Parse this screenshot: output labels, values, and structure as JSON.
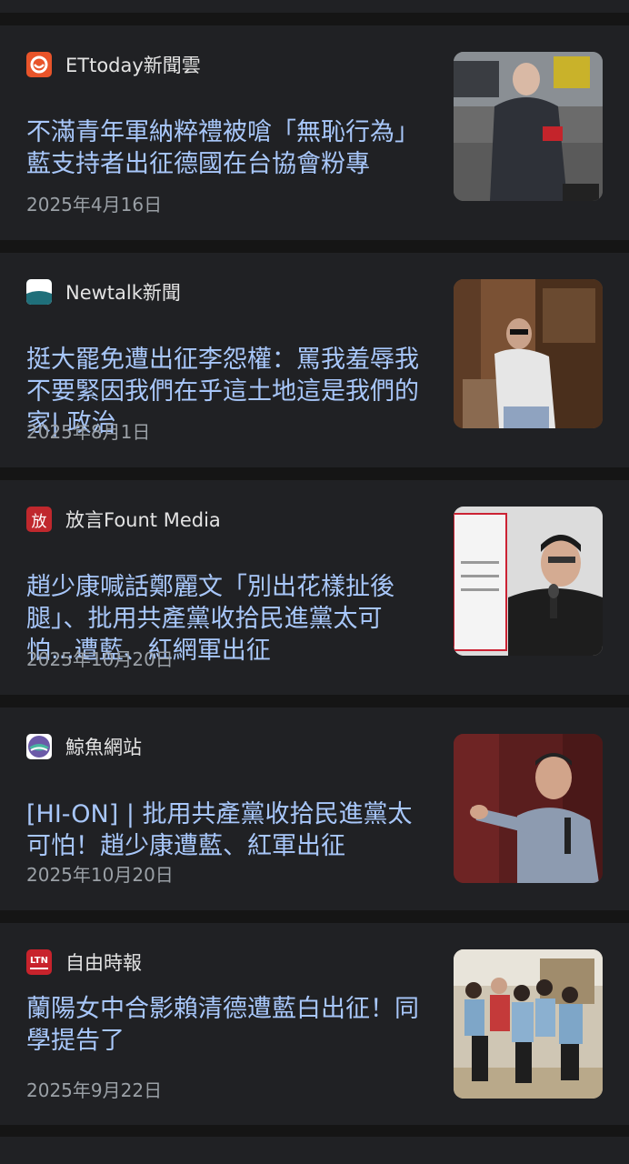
{
  "articles": [
    {
      "source": "ETtoday新聞雲",
      "favicon": "ettoday-logo-icon",
      "title": "不滿青年軍納粹禮被嗆「無恥行為」　藍支持者出征德國在台協會粉專",
      "date": "2025年4月16日",
      "image": "man-armband-photo"
    },
    {
      "source": "Newtalk新聞",
      "favicon": "newtalk-logo-icon",
      "title": "挺大罷免遭出征李怨權：罵我羞辱我不要緊因我們在乎這土地這是我們的家| 政治",
      "date": "2025年8月1日",
      "image": "man-sunglasses-doorway-photo"
    },
    {
      "source": "放言Fount Media",
      "favicon": "fount-media-logo-icon",
      "favicon_text": "放",
      "title": "趙少康喊話鄭麗文「別出花樣扯後腿」、批用共產黨收拾民進黨太可怕...遭藍、紅網軍出征",
      "date": "2025年10月20日",
      "image": "man-microphone-photo"
    },
    {
      "source": "鯨魚網站",
      "favicon": "whale-logo-icon",
      "title": "[HI-ON] | 批用共產黨收拾民進黨太可怕！趙少康遭藍、紅軍出征",
      "date": "2025年10月20日",
      "image": "man-pointing-photo"
    },
    {
      "source": "自由時報",
      "favicon": "ltn-logo-icon",
      "favicon_text": "LTN",
      "title": "蘭陽女中合影賴清德遭藍白出征！同學提告了",
      "date": "2025年9月22日",
      "image": "students-group-photo"
    }
  ],
  "colors": {
    "background": "#151515",
    "card": "#202124",
    "title": "#a8c7fa",
    "source": "#e3e3e3",
    "date": "#9aa0a6"
  }
}
